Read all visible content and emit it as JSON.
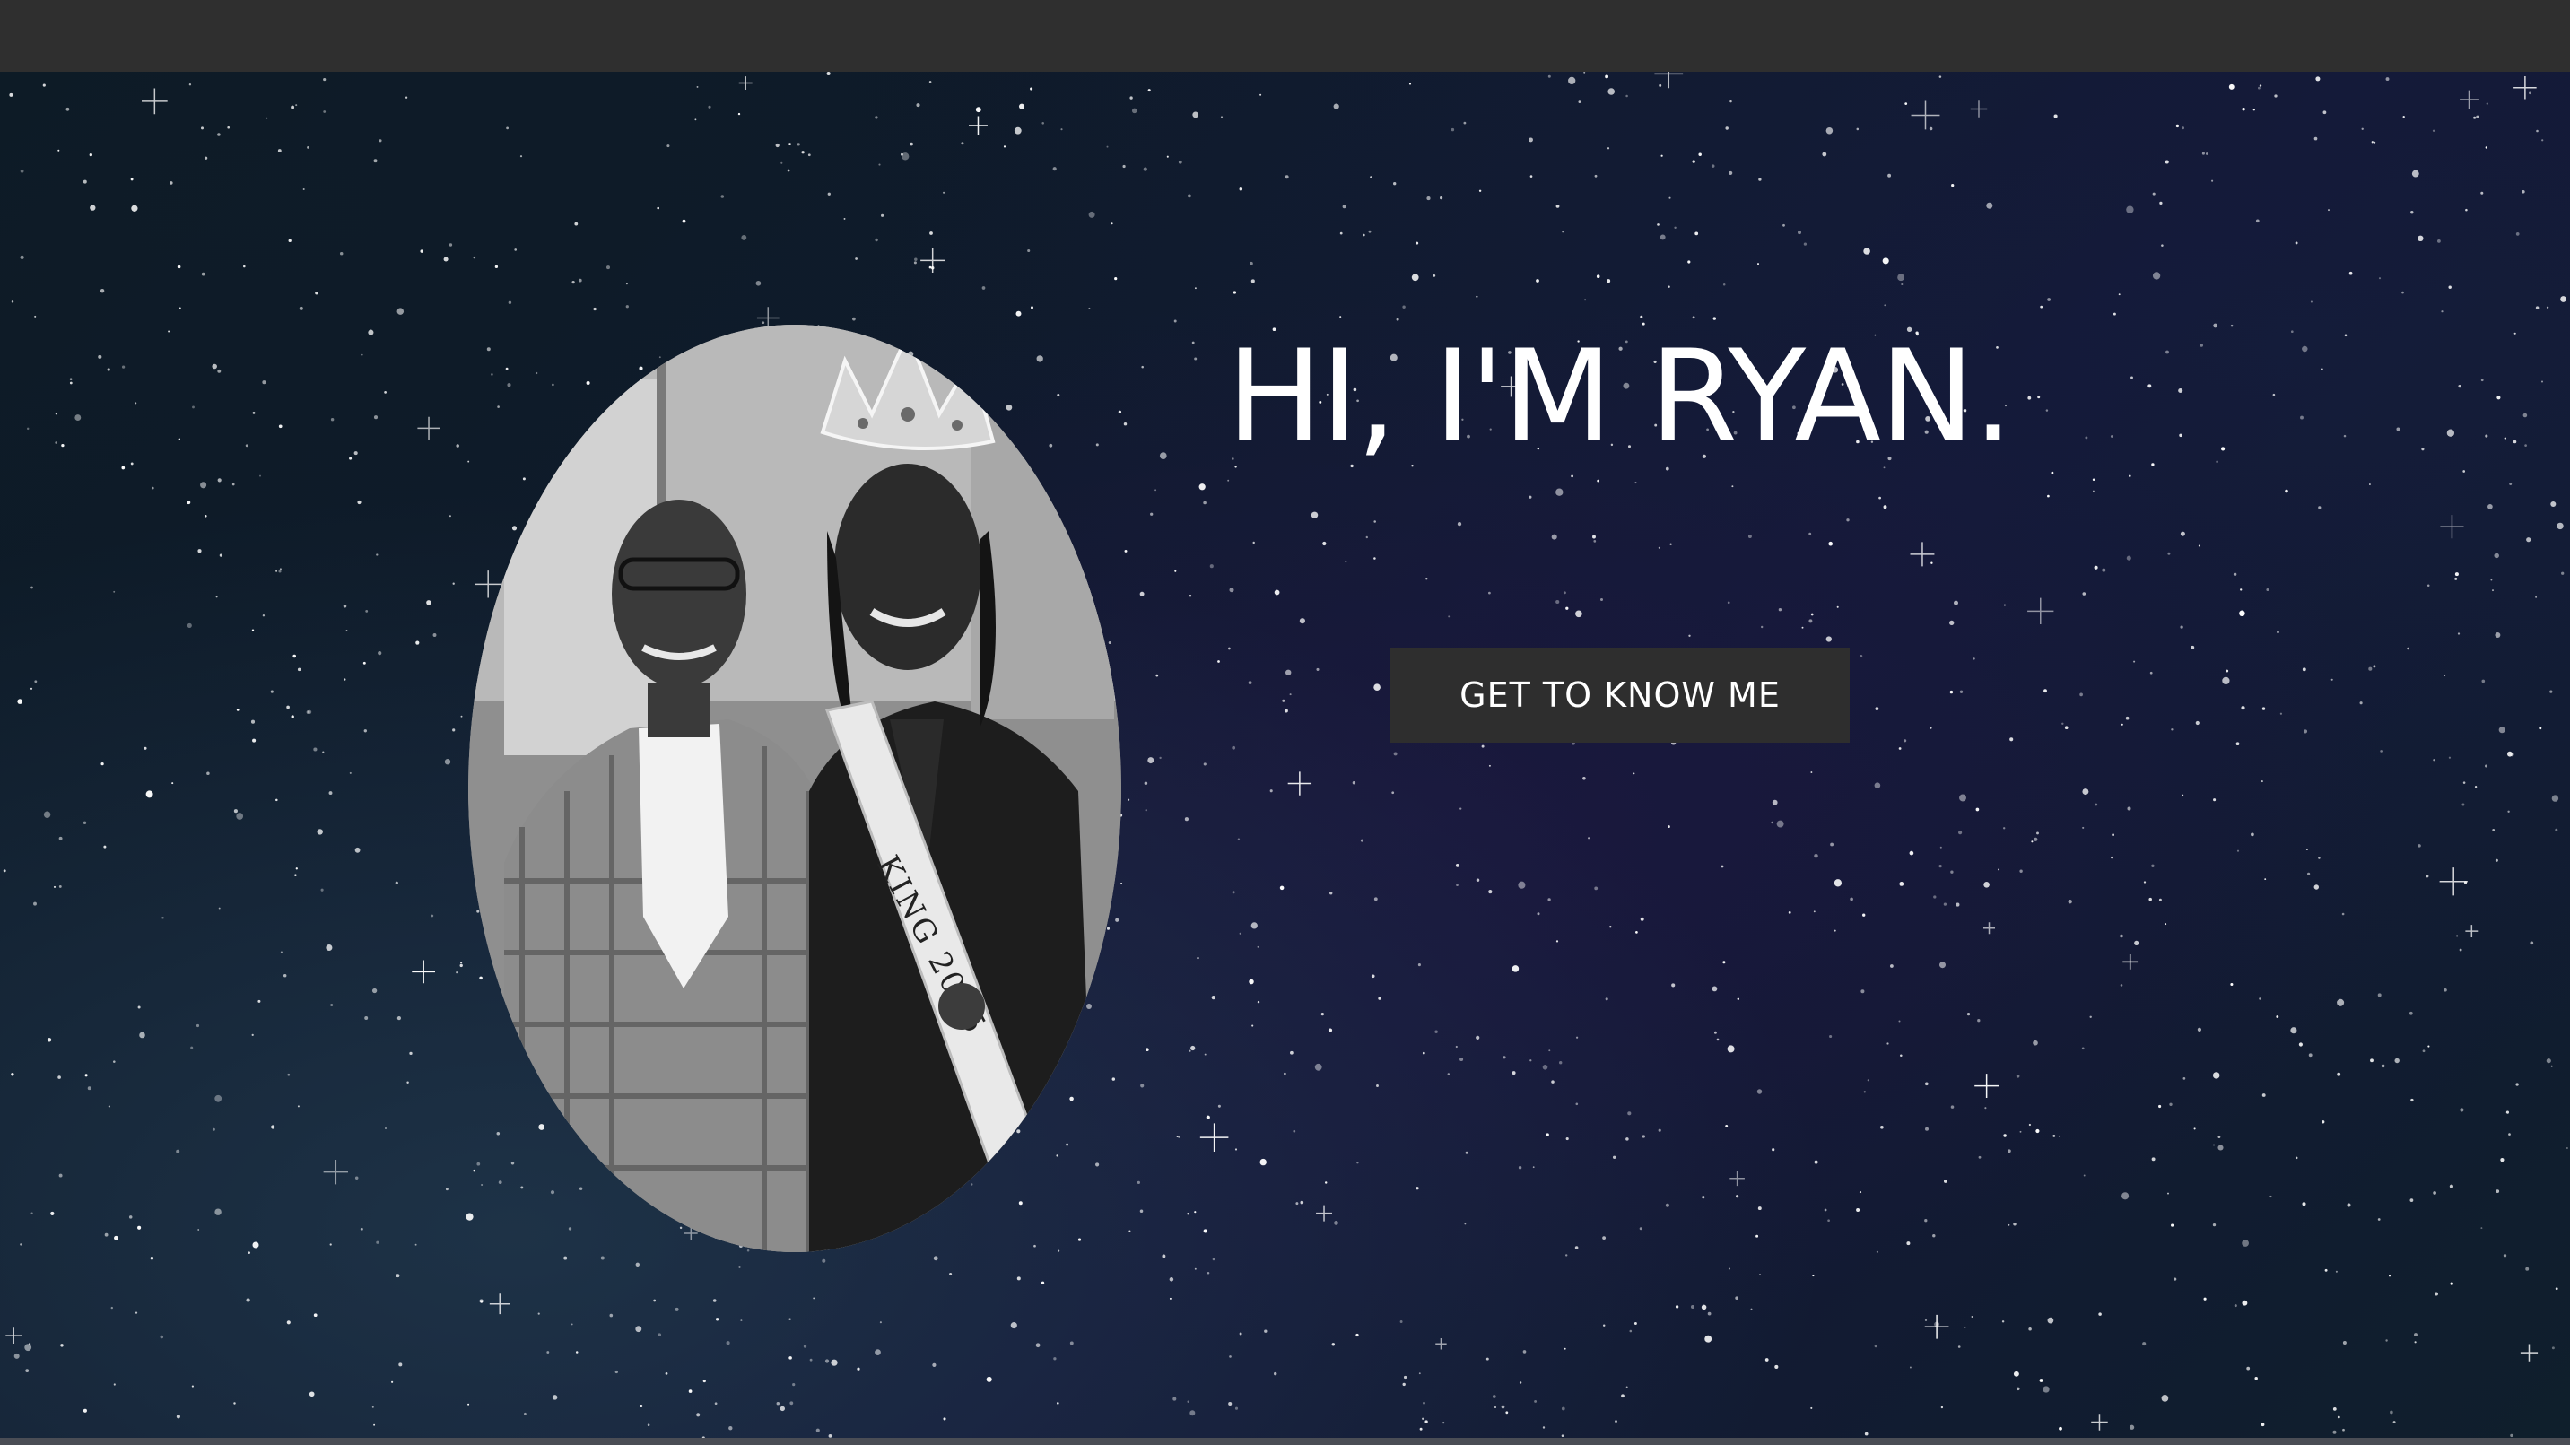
{
  "hero": {
    "headline": "HI, I'M RYAN.",
    "cta_label": "GET TO KNOW ME",
    "portrait": {
      "alt": "Two men posing, one wearing a crown and sash",
      "sash_text": "KING 2015"
    }
  },
  "colors": {
    "topbar": "#2f2f2f",
    "button_bg": "#2e2e2e",
    "text": "#ffffff",
    "sky_dark": "#0c1a24",
    "sky_purple": "#141737"
  }
}
